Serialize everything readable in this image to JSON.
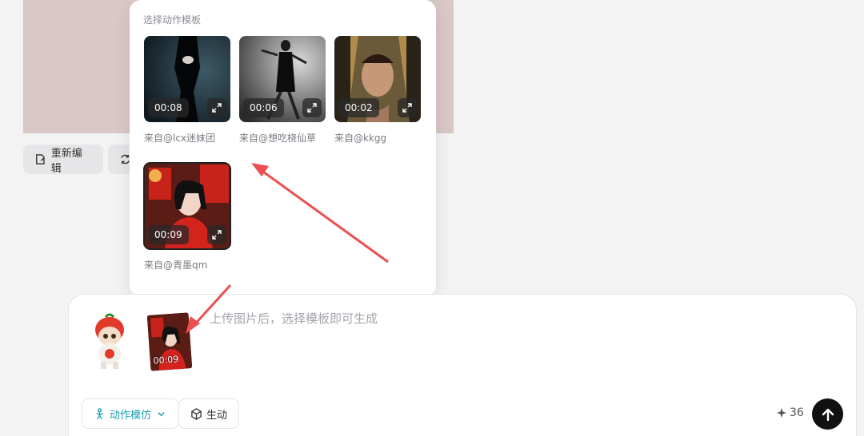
{
  "toolbar": {
    "reedit_label": "重新编辑",
    "regen_label": ""
  },
  "popup": {
    "title": "选择动作模板",
    "templates": [
      {
        "duration": "00:08",
        "author": "来自@lcx迷妹团"
      },
      {
        "duration": "00:06",
        "author": "来自@想吃桡仙草"
      },
      {
        "duration": "00:02",
        "author": "来自@kkgg"
      },
      {
        "duration": "00:09",
        "author": "来自@青墨qm"
      }
    ]
  },
  "composer": {
    "attached_duration": "00:09",
    "placeholder": "上传图片后，选择模板即可生成",
    "mode_label": "动作模仿",
    "lively_label": "生动",
    "credits": "36",
    "credits_icon": "sparkle-icon",
    "send_icon": "arrow-up-icon"
  },
  "colors": {
    "accent": "#1a9fb0",
    "arrow": "#ec4f4f",
    "send_bg": "#111111"
  }
}
